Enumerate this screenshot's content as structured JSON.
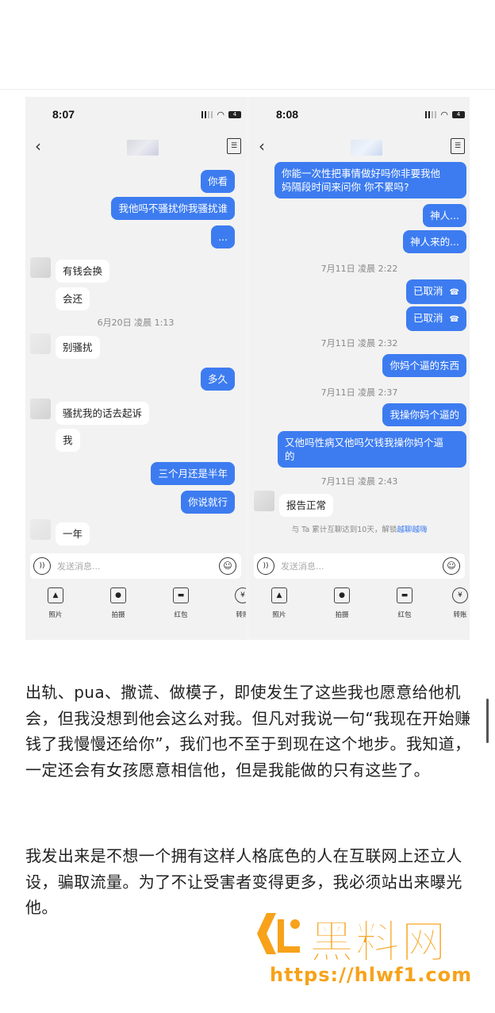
{
  "left_phone": {
    "time": "8:07",
    "battery": "4",
    "messages": {
      "m1": "你看",
      "m2": "我他吗不骚扰你我骚扰谁",
      "m3": "...",
      "m4": "有钱会换",
      "m5": "会还",
      "t1": "6月20日 凌晨 1:13",
      "m6": "别骚扰",
      "m7": "多久",
      "m8": "骚扰我的话去起诉",
      "m9": "我",
      "m10": "三个月还是半年",
      "m11": "你说就行",
      "m12": "一年"
    },
    "input_placeholder": "发送消息...",
    "tools": [
      "照片",
      "拍摄",
      "红包",
      "转账"
    ]
  },
  "right_phone": {
    "time": "8:08",
    "battery": "4",
    "messages": {
      "m1a": "你能一次性把事情做好吗你非要我他",
      "m1b": "妈隔段时间来问你 你不累吗?",
      "m2": "神人...",
      "m3": "神人来的...",
      "t1": "7月11日 凌晨 2:22",
      "m4": "已取消",
      "m5": "已取消",
      "t2": "7月11日 凌晨 2:32",
      "m6": "你妈个逼的东西",
      "t3": "7月11日 凌晨 2:37",
      "m7": "我操你妈个逼的",
      "m8a": "又他吗性病又他吗欠钱我操你妈个逼",
      "m8b": "的",
      "t4": "7月11日 凌晨 2:43",
      "m9": "报告正常",
      "notice": "与 Ta 累计互聊达到10天，解锁",
      "notice_link": "越聊越嗨"
    },
    "input_placeholder": "发送消息...",
    "tools": [
      "照片",
      "拍摄",
      "红包",
      "转账"
    ]
  },
  "article": {
    "p1": "出轨、pua、撒谎、做模子，即使发生了这些我也愿意给他机会，但我没想到他会这么对我。但凡对我说一句“我现在开始赚钱了我慢慢还给你”，我们也不至于到现在这个地步。我知道，一定还会有女孩愿意相信他，但是我能做的只有这些了。",
    "p2": "我发出来是不想一个拥有这样人格底色的人在互联网上还立人设，骗取流量。为了不让受害者变得更多，我必须站出来曝光他。"
  },
  "watermark": {
    "title": "黑料网",
    "url": "https://hlwf1.com"
  },
  "colors": {
    "bubble_me": "#3d7cf0",
    "bubble_them": "#ffffff",
    "watermark": "#f7a21a"
  }
}
